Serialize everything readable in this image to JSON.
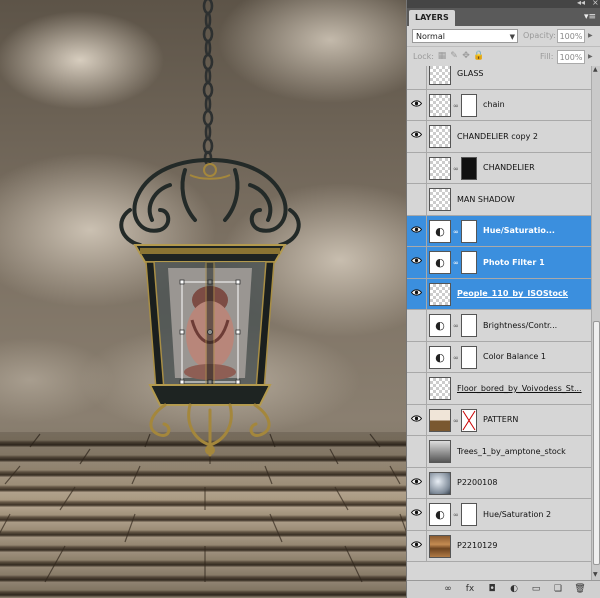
{
  "panel": {
    "title": "LAYERS",
    "collapse_glyph": "◂◂",
    "close_glyph": "×",
    "menu_glyph": "▾≡",
    "blend_mode": "Normal",
    "opacity_label": "Opacity:",
    "opacity_value": "100%",
    "lock_label": "Lock:",
    "fill_label": "Fill:",
    "fill_value": "100%"
  },
  "layers": [
    {
      "name": "GLASS",
      "visible": false,
      "thumb": "transparent"
    },
    {
      "name": "chain",
      "visible": true,
      "thumb": "transparent",
      "mask": "white"
    },
    {
      "name": "CHANDELIER copy 2",
      "visible": true,
      "thumb": "transparent"
    },
    {
      "name": "CHANDELIER",
      "visible": false,
      "thumb": "transparent",
      "mask": "black"
    },
    {
      "name": "MAN SHADOW",
      "visible": false,
      "clipped": true,
      "thumb": "transparent"
    },
    {
      "name": "Hue/Saturatio...",
      "visible": true,
      "clipped": true,
      "thumb": "adjustment",
      "mask": "white",
      "selected": true
    },
    {
      "name": "Photo Filter 1",
      "visible": true,
      "clipped": true,
      "thumb": "adjustment",
      "mask": "white",
      "selected": true
    },
    {
      "name": "People_110_by_ISOStock",
      "visible": true,
      "thumb": "transparent",
      "selected": true,
      "underline": true
    },
    {
      "name": "Brightness/Contr...",
      "visible": false,
      "clipped": true,
      "thumb": "adjustment",
      "mask": "white"
    },
    {
      "name": "Color Balance 1",
      "visible": false,
      "clipped": true,
      "thumb": "adjustment",
      "mask": "white"
    },
    {
      "name": "Floor_bored_by_Voivodess_St...",
      "visible": false,
      "thumb": "transparent",
      "underline": true
    },
    {
      "name": "PATTERN",
      "visible": true,
      "thumb": "floorwood",
      "mask": "x"
    },
    {
      "name": "Trees_1_by_amptone_stock",
      "visible": false,
      "thumb": "tree"
    },
    {
      "name": "P2200108",
      "visible": true,
      "thumb": "cloud"
    },
    {
      "name": "Hue/Saturation 2",
      "visible": true,
      "thumb": "adjustment",
      "mask": "white"
    },
    {
      "name": "P2210129",
      "visible": true,
      "thumb": "wood"
    }
  ],
  "bottom_icons": [
    "link-layers-icon",
    "fx-icon",
    "add-mask-icon",
    "adjustment-layer-icon",
    "new-group-icon",
    "new-layer-icon",
    "trash-icon"
  ],
  "bottom_glyphs": [
    "∞",
    "fx",
    "◘",
    "◐",
    "▭",
    "❏",
    "🗑"
  ],
  "colors": {
    "selected": "#3b8fde",
    "panel": "#d6d6d6",
    "tab_bar": "#5a5a5a"
  }
}
